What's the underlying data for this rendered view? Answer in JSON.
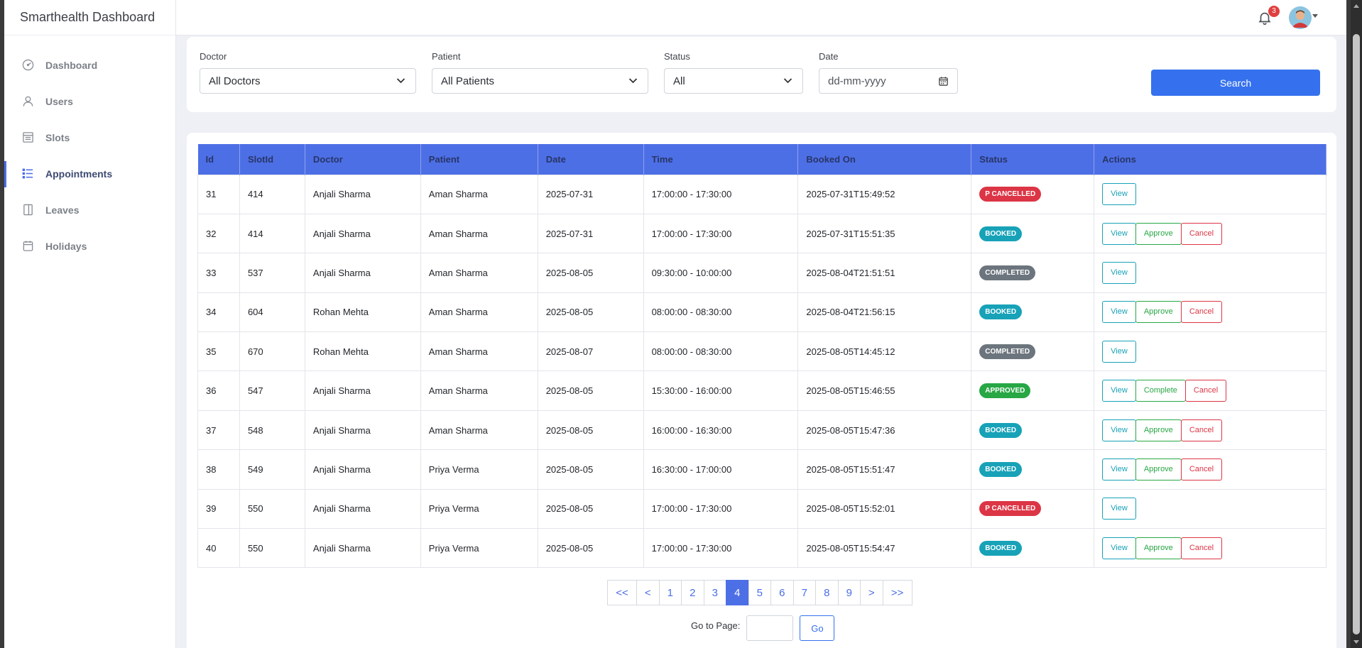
{
  "app": {
    "title": "Smarthealth Dashboard"
  },
  "sidebar": {
    "items": [
      {
        "label": "Dashboard",
        "icon": "dashboard-icon"
      },
      {
        "label": "Users",
        "icon": "user-icon"
      },
      {
        "label": "Slots",
        "icon": "slots-icon"
      },
      {
        "label": "Appointments",
        "icon": "list-icon",
        "active": true
      },
      {
        "label": "Leaves",
        "icon": "leaves-icon"
      },
      {
        "label": "Holidays",
        "icon": "holidays-icon"
      }
    ]
  },
  "topbar": {
    "notification_count": "3"
  },
  "filters": {
    "doctor_label": "Doctor",
    "doctor_value": "All Doctors",
    "patient_label": "Patient",
    "patient_value": "All Patients",
    "status_label": "Status",
    "status_value": "All",
    "date_label": "Date",
    "date_placeholder": "dd-mm-yyyy",
    "search_label": "Search"
  },
  "table": {
    "headers": [
      "Id",
      "SlotId",
      "Doctor",
      "Patient",
      "Date",
      "Time",
      "Booked On",
      "Status",
      "Actions"
    ],
    "rows": [
      {
        "id": "31",
        "slot": "414",
        "doctor": "Anjali Sharma",
        "patient": "Aman Sharma",
        "date": "2025-07-31",
        "time": "17:00:00 - 17:30:00",
        "booked_on": "2025-07-31T15:49:52",
        "status": "P CANCELLED",
        "actions": [
          "View"
        ]
      },
      {
        "id": "32",
        "slot": "414",
        "doctor": "Anjali Sharma",
        "patient": "Aman Sharma",
        "date": "2025-07-31",
        "time": "17:00:00 - 17:30:00",
        "booked_on": "2025-07-31T15:51:35",
        "status": "BOOKED",
        "actions": [
          "View",
          "Approve",
          "Cancel"
        ]
      },
      {
        "id": "33",
        "slot": "537",
        "doctor": "Anjali Sharma",
        "patient": "Aman Sharma",
        "date": "2025-08-05",
        "time": "09:30:00 - 10:00:00",
        "booked_on": "2025-08-04T21:51:51",
        "status": "COMPLETED",
        "actions": [
          "View"
        ]
      },
      {
        "id": "34",
        "slot": "604",
        "doctor": "Rohan Mehta",
        "patient": "Aman Sharma",
        "date": "2025-08-05",
        "time": "08:00:00 - 08:30:00",
        "booked_on": "2025-08-04T21:56:15",
        "status": "BOOKED",
        "actions": [
          "View",
          "Approve",
          "Cancel"
        ]
      },
      {
        "id": "35",
        "slot": "670",
        "doctor": "Rohan Mehta",
        "patient": "Aman Sharma",
        "date": "2025-08-07",
        "time": "08:00:00 - 08:30:00",
        "booked_on": "2025-08-05T14:45:12",
        "status": "COMPLETED",
        "actions": [
          "View"
        ]
      },
      {
        "id": "36",
        "slot": "547",
        "doctor": "Anjali Sharma",
        "patient": "Aman Sharma",
        "date": "2025-08-05",
        "time": "15:30:00 - 16:00:00",
        "booked_on": "2025-08-05T15:46:55",
        "status": "APPROVED",
        "actions": [
          "View",
          "Complete",
          "Cancel"
        ]
      },
      {
        "id": "37",
        "slot": "548",
        "doctor": "Anjali Sharma",
        "patient": "Aman Sharma",
        "date": "2025-08-05",
        "time": "16:00:00 - 16:30:00",
        "booked_on": "2025-08-05T15:47:36",
        "status": "BOOKED",
        "actions": [
          "View",
          "Approve",
          "Cancel"
        ]
      },
      {
        "id": "38",
        "slot": "549",
        "doctor": "Anjali Sharma",
        "patient": "Priya Verma",
        "date": "2025-08-05",
        "time": "16:30:00 - 17:00:00",
        "booked_on": "2025-08-05T15:51:47",
        "status": "BOOKED",
        "actions": [
          "View",
          "Approve",
          "Cancel"
        ]
      },
      {
        "id": "39",
        "slot": "550",
        "doctor": "Anjali Sharma",
        "patient": "Priya Verma",
        "date": "2025-08-05",
        "time": "17:00:00 - 17:30:00",
        "booked_on": "2025-08-05T15:52:01",
        "status": "P CANCELLED",
        "actions": [
          "View"
        ]
      },
      {
        "id": "40",
        "slot": "550",
        "doctor": "Anjali Sharma",
        "patient": "Priya Verma",
        "date": "2025-08-05",
        "time": "17:00:00 - 17:30:00",
        "booked_on": "2025-08-05T15:54:47",
        "status": "BOOKED",
        "actions": [
          "View",
          "Approve",
          "Cancel"
        ]
      }
    ]
  },
  "pagination": {
    "first": "<<",
    "prev": "<",
    "next": ">",
    "last": ">>",
    "pages": [
      "1",
      "2",
      "3",
      "4",
      "5",
      "6",
      "7",
      "8",
      "9"
    ],
    "current": "4",
    "goto_label": "Go to Page:",
    "go_label": "Go"
  },
  "colors": {
    "primary": "#3571ee",
    "header": "#4d6fe6",
    "booked": "#17a2b8",
    "cancelled": "#dc3545",
    "completed": "#6c757d",
    "approved": "#28a745"
  }
}
